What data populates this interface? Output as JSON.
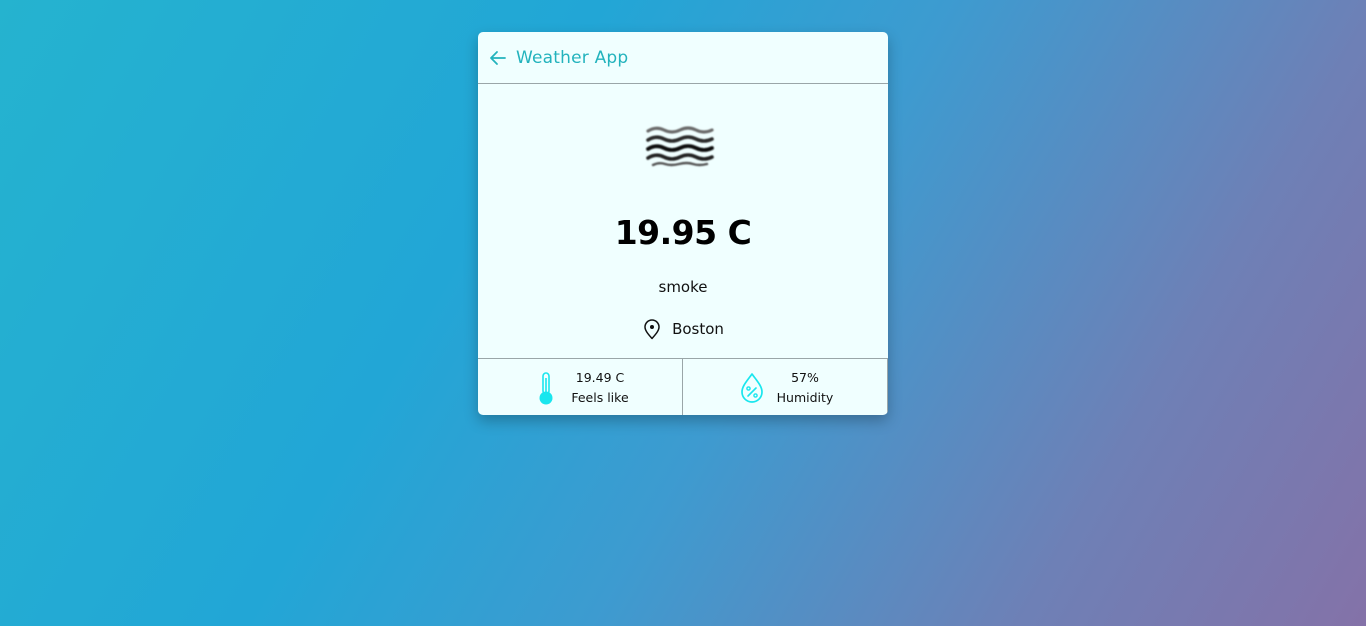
{
  "app": {
    "title": "Weather App",
    "accent_color": "#23b3bd",
    "icon_color": "#19e6ee"
  },
  "header": {
    "back_icon": "arrow-left-icon",
    "title": "Weather App"
  },
  "weather": {
    "icon": "smoke-waves-icon",
    "temperature": "19.95 C",
    "description": "smoke",
    "location_icon": "map-pin-icon",
    "location": "Boston"
  },
  "stats": {
    "feels_like": {
      "icon": "thermometer-icon",
      "value": "19.49 C",
      "label": "Feels like"
    },
    "humidity": {
      "icon": "humidity-drop-icon",
      "value": "57%",
      "label": "Humidity"
    }
  }
}
